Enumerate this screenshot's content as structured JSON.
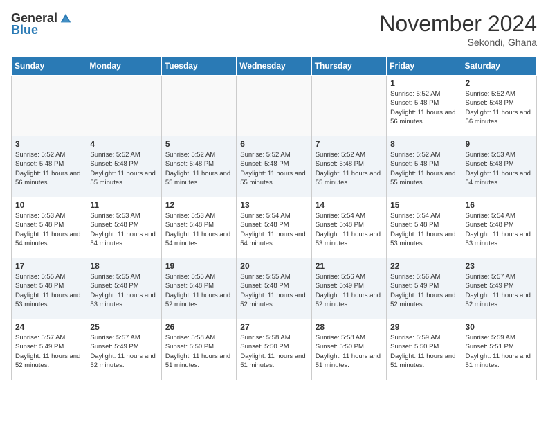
{
  "logo": {
    "general": "General",
    "blue": "Blue"
  },
  "title": "November 2024",
  "location": "Sekondi, Ghana",
  "days_header": [
    "Sunday",
    "Monday",
    "Tuesday",
    "Wednesday",
    "Thursday",
    "Friday",
    "Saturday"
  ],
  "weeks": [
    [
      {
        "day": "",
        "info": ""
      },
      {
        "day": "",
        "info": ""
      },
      {
        "day": "",
        "info": ""
      },
      {
        "day": "",
        "info": ""
      },
      {
        "day": "",
        "info": ""
      },
      {
        "day": "1",
        "info": "Sunrise: 5:52 AM\nSunset: 5:48 PM\nDaylight: 11 hours\nand 56 minutes."
      },
      {
        "day": "2",
        "info": "Sunrise: 5:52 AM\nSunset: 5:48 PM\nDaylight: 11 hours\nand 56 minutes."
      }
    ],
    [
      {
        "day": "3",
        "info": "Sunrise: 5:52 AM\nSunset: 5:48 PM\nDaylight: 11 hours\nand 56 minutes."
      },
      {
        "day": "4",
        "info": "Sunrise: 5:52 AM\nSunset: 5:48 PM\nDaylight: 11 hours\nand 55 minutes."
      },
      {
        "day": "5",
        "info": "Sunrise: 5:52 AM\nSunset: 5:48 PM\nDaylight: 11 hours\nand 55 minutes."
      },
      {
        "day": "6",
        "info": "Sunrise: 5:52 AM\nSunset: 5:48 PM\nDaylight: 11 hours\nand 55 minutes."
      },
      {
        "day": "7",
        "info": "Sunrise: 5:52 AM\nSunset: 5:48 PM\nDaylight: 11 hours\nand 55 minutes."
      },
      {
        "day": "8",
        "info": "Sunrise: 5:52 AM\nSunset: 5:48 PM\nDaylight: 11 hours\nand 55 minutes."
      },
      {
        "day": "9",
        "info": "Sunrise: 5:53 AM\nSunset: 5:48 PM\nDaylight: 11 hours\nand 54 minutes."
      }
    ],
    [
      {
        "day": "10",
        "info": "Sunrise: 5:53 AM\nSunset: 5:48 PM\nDaylight: 11 hours\nand 54 minutes."
      },
      {
        "day": "11",
        "info": "Sunrise: 5:53 AM\nSunset: 5:48 PM\nDaylight: 11 hours\nand 54 minutes."
      },
      {
        "day": "12",
        "info": "Sunrise: 5:53 AM\nSunset: 5:48 PM\nDaylight: 11 hours\nand 54 minutes."
      },
      {
        "day": "13",
        "info": "Sunrise: 5:54 AM\nSunset: 5:48 PM\nDaylight: 11 hours\nand 54 minutes."
      },
      {
        "day": "14",
        "info": "Sunrise: 5:54 AM\nSunset: 5:48 PM\nDaylight: 11 hours\nand 53 minutes."
      },
      {
        "day": "15",
        "info": "Sunrise: 5:54 AM\nSunset: 5:48 PM\nDaylight: 11 hours\nand 53 minutes."
      },
      {
        "day": "16",
        "info": "Sunrise: 5:54 AM\nSunset: 5:48 PM\nDaylight: 11 hours\nand 53 minutes."
      }
    ],
    [
      {
        "day": "17",
        "info": "Sunrise: 5:55 AM\nSunset: 5:48 PM\nDaylight: 11 hours\nand 53 minutes."
      },
      {
        "day": "18",
        "info": "Sunrise: 5:55 AM\nSunset: 5:48 PM\nDaylight: 11 hours\nand 53 minutes."
      },
      {
        "day": "19",
        "info": "Sunrise: 5:55 AM\nSunset: 5:48 PM\nDaylight: 11 hours\nand 52 minutes."
      },
      {
        "day": "20",
        "info": "Sunrise: 5:55 AM\nSunset: 5:48 PM\nDaylight: 11 hours\nand 52 minutes."
      },
      {
        "day": "21",
        "info": "Sunrise: 5:56 AM\nSunset: 5:49 PM\nDaylight: 11 hours\nand 52 minutes."
      },
      {
        "day": "22",
        "info": "Sunrise: 5:56 AM\nSunset: 5:49 PM\nDaylight: 11 hours\nand 52 minutes."
      },
      {
        "day": "23",
        "info": "Sunrise: 5:57 AM\nSunset: 5:49 PM\nDaylight: 11 hours\nand 52 minutes."
      }
    ],
    [
      {
        "day": "24",
        "info": "Sunrise: 5:57 AM\nSunset: 5:49 PM\nDaylight: 11 hours\nand 52 minutes."
      },
      {
        "day": "25",
        "info": "Sunrise: 5:57 AM\nSunset: 5:49 PM\nDaylight: 11 hours\nand 52 minutes."
      },
      {
        "day": "26",
        "info": "Sunrise: 5:58 AM\nSunset: 5:50 PM\nDaylight: 11 hours\nand 51 minutes."
      },
      {
        "day": "27",
        "info": "Sunrise: 5:58 AM\nSunset: 5:50 PM\nDaylight: 11 hours\nand 51 minutes."
      },
      {
        "day": "28",
        "info": "Sunrise: 5:58 AM\nSunset: 5:50 PM\nDaylight: 11 hours\nand 51 minutes."
      },
      {
        "day": "29",
        "info": "Sunrise: 5:59 AM\nSunset: 5:50 PM\nDaylight: 11 hours\nand 51 minutes."
      },
      {
        "day": "30",
        "info": "Sunrise: 5:59 AM\nSunset: 5:51 PM\nDaylight: 11 hours\nand 51 minutes."
      }
    ]
  ]
}
